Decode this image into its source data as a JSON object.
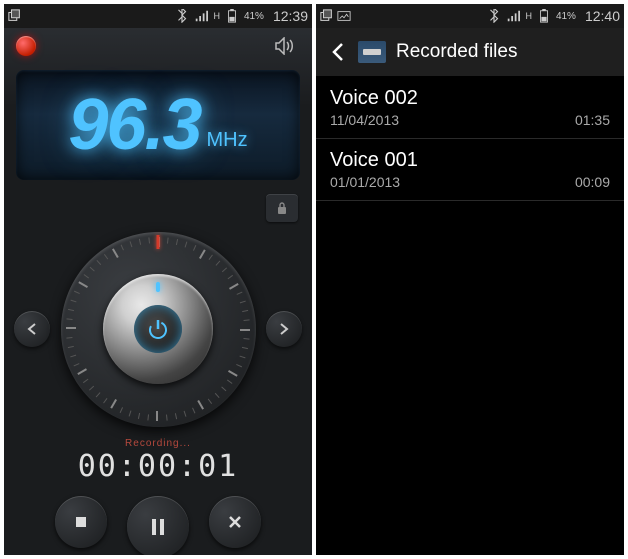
{
  "radio": {
    "statusbar": {
      "battery": "41%",
      "time": "12:39"
    },
    "frequency": "96.3",
    "unit": "MHz",
    "recording_label": "Recording...",
    "timer": "00:00:01"
  },
  "files": {
    "statusbar": {
      "battery": "41%",
      "time": "12:40"
    },
    "header": "Recorded files",
    "items": [
      {
        "name": "Voice 002",
        "date": "11/04/2013",
        "duration": "01:35"
      },
      {
        "name": "Voice 001",
        "date": "01/01/2013",
        "duration": "00:09"
      }
    ]
  }
}
